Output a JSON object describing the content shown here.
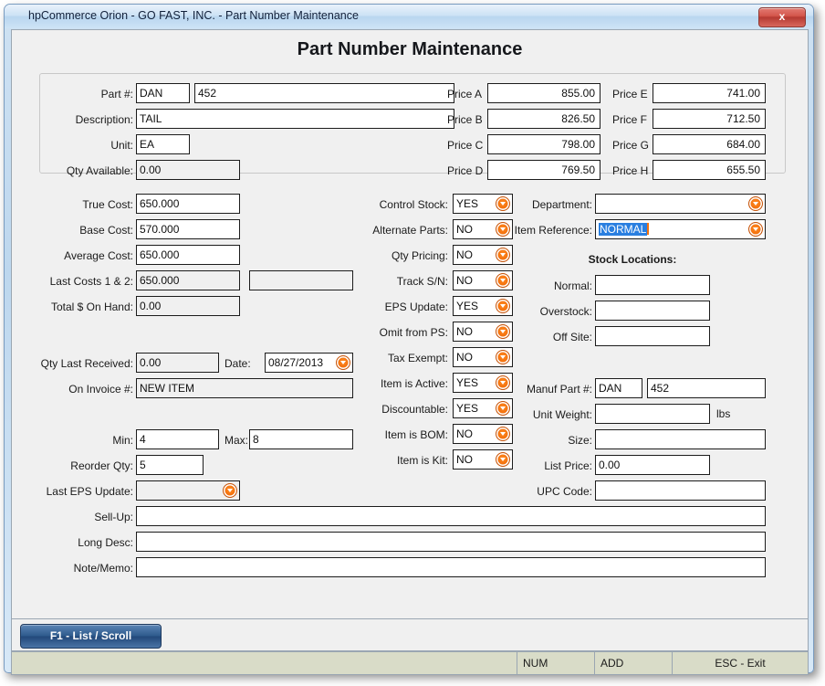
{
  "window": {
    "title": "hpCommerce Orion - GO FAST, INC. - Part Number Maintenance",
    "close_label": "x"
  },
  "page_title": "Part Number Maintenance",
  "header_group": {
    "part_label": "Part #:",
    "part_prefix": "DAN",
    "part_number": "452",
    "description_label": "Description:",
    "description": "TAIL",
    "unit_label": "Unit:",
    "unit": "EA",
    "qty_available_label": "Qty Available:",
    "qty_available": "0.00",
    "prices": [
      {
        "label": "Price A",
        "value": "855.00"
      },
      {
        "label": "Price B",
        "value": "826.50"
      },
      {
        "label": "Price C",
        "value": "798.00"
      },
      {
        "label": "Price D",
        "value": "769.50"
      },
      {
        "label": "Price E",
        "value": "741.00"
      },
      {
        "label": "Price F",
        "value": "712.50"
      },
      {
        "label": "Price G",
        "value": "684.00"
      },
      {
        "label": "Price H",
        "value": "655.50"
      }
    ]
  },
  "costs": {
    "true_cost_label": "True Cost:",
    "true_cost": "650.000",
    "base_cost_label": "Base Cost:",
    "base_cost": "570.000",
    "average_cost_label": "Average Cost:",
    "average_cost": "650.000",
    "last_costs_label": "Last Costs 1 & 2:",
    "last_cost_1": "650.000",
    "last_cost_2": "",
    "total_on_hand_label": "Total $ On Hand:",
    "total_on_hand": "0.00"
  },
  "receiving": {
    "qty_last_received_label": "Qty Last Received:",
    "qty_last_received": "0.00",
    "date_label": "Date:",
    "date": "08/27/2013",
    "on_invoice_label": "On Invoice #:",
    "on_invoice": "NEW ITEM"
  },
  "reorder": {
    "min_label": "Min:",
    "min": "4",
    "max_label": "Max:",
    "max": "8",
    "reorder_qty_label": "Reorder Qty:",
    "reorder_qty": "5",
    "last_eps_update_label": "Last EPS Update:",
    "last_eps_update": ""
  },
  "flags": [
    {
      "label": "Control Stock:",
      "value": "YES"
    },
    {
      "label": "Alternate Parts:",
      "value": "NO"
    },
    {
      "label": "Qty Pricing:",
      "value": "NO"
    },
    {
      "label": "Track S/N:",
      "value": "NO"
    },
    {
      "label": "EPS Update:",
      "value": "YES"
    },
    {
      "label": "Omit from PS:",
      "value": "NO"
    },
    {
      "label": "Tax Exempt:",
      "value": "NO"
    },
    {
      "label": "Item is Active:",
      "value": "YES"
    },
    {
      "label": "Discountable:",
      "value": "YES"
    },
    {
      "label": "Item is BOM:",
      "value": "NO"
    },
    {
      "label": "Item is Kit:",
      "value": "NO"
    }
  ],
  "right": {
    "department_label": "Department:",
    "department": "",
    "item_reference_label": "Item Reference:",
    "item_reference": "NORMAL",
    "stock_locations_title": "Stock Locations:",
    "normal_label": "Normal:",
    "normal": "",
    "overstock_label": "Overstock:",
    "overstock": "",
    "off_site_label": "Off Site:",
    "off_site": "",
    "manuf_part_label": "Manuf Part #:",
    "manuf_part_prefix": "DAN",
    "manuf_part_number": "452",
    "unit_weight_label": "Unit Weight:",
    "unit_weight": "",
    "unit_weight_units": "lbs",
    "size_label": "Size:",
    "size": "",
    "list_price_label": "List Price:",
    "list_price": "0.00",
    "upc_label": "UPC Code:",
    "upc": ""
  },
  "memos": {
    "sell_up_label": "Sell-Up:",
    "sell_up": "",
    "long_desc_label": "Long Desc:",
    "long_desc": "",
    "note_memo_label": "Note/Memo:",
    "note_memo": ""
  },
  "footer": {
    "f1_label": "F1 - List / Scroll",
    "status_blank": "",
    "num_label": "NUM",
    "add_label": "ADD",
    "esc_label": "ESC - Exit"
  },
  "colors": {
    "accent_orange": "#f4720d",
    "selection_blue": "#2a7fe0",
    "button_blue": "#2f5b8d",
    "status_bg": "#d9dcc8"
  }
}
